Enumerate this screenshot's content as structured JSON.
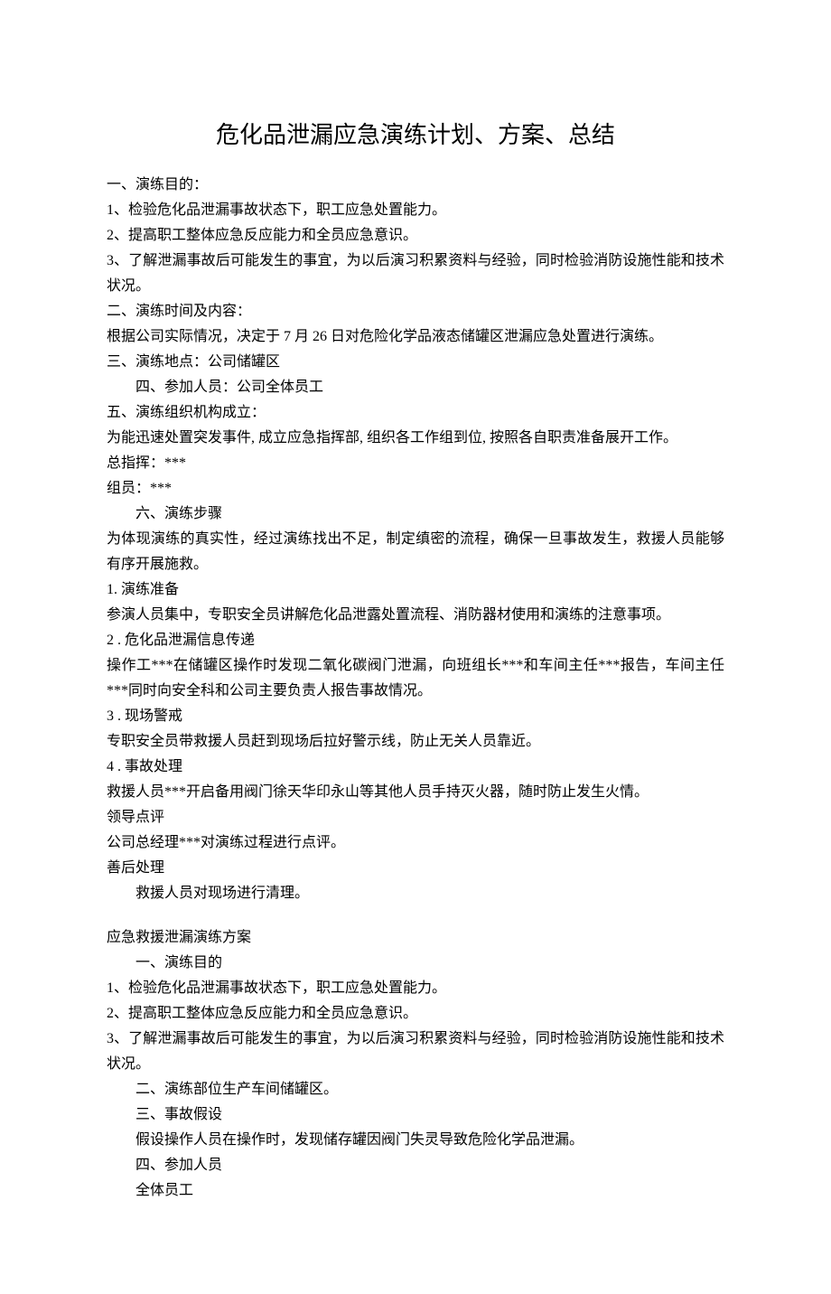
{
  "title": "危化品泄漏应急演练计划、方案、总结",
  "paragraphs": [
    {
      "text": "一、演练目的：",
      "indent": false
    },
    {
      "text": "1、检验危化品泄漏事故状态下，职工应急处置能力。",
      "indent": false
    },
    {
      "text": "2、提高职工整体应急反应能力和全员应急意识。",
      "indent": false
    },
    {
      "text": "3、了解泄漏事故后可能发生的事宜，为以后演习积累资料与经验，同时检验消防设施性能和技术状况。",
      "indent": false
    },
    {
      "text": "二、演练时间及内容：",
      "indent": false
    },
    {
      "text": "根据公司实际情况，决定于 7 月 26 日对危险化学品液态储罐区泄漏应急处置进行演练。",
      "indent": false
    },
    {
      "text": "三、演练地点：公司储罐区",
      "indent": false
    },
    {
      "text": "四、参加人员：公司全体员工",
      "indent": true
    },
    {
      "text": "五、演练组织机构成立：",
      "indent": false
    },
    {
      "text": "为能迅速处置突发事件, 成立应急指挥部, 组织各工作组到位, 按照各自职责准备展开工作。",
      "indent": false
    },
    {
      "text": "总指挥：***",
      "indent": false
    },
    {
      "text": "组员：***",
      "indent": false
    },
    {
      "text": "六、演练步骤",
      "indent": true
    },
    {
      "text": "为体现演练的真实性，经过演练找出不足，制定缜密的流程，确保一旦事故发生，救援人员能够有序开展施救。",
      "indent": false
    },
    {
      "text": "1. 演练准备",
      "indent": false
    },
    {
      "text": "参演人员集中，专职安全员讲解危化品泄露处置流程、消防器材使用和演练的注意事项。",
      "indent": false
    },
    {
      "text": "2  . 危化品泄漏信息传递",
      "indent": false
    },
    {
      "text": "操作工***在储罐区操作时发现二氧化碳阀门泄漏，向班组长***和车间主任***报告，车间主任***同时向安全科和公司主要负责人报告事故情况。",
      "indent": false
    },
    {
      "text": "3  . 现场警戒",
      "indent": false
    },
    {
      "text": "专职安全员带救援人员赶到现场后拉好警示线，防止无关人员靠近。",
      "indent": false
    },
    {
      "text": "4  . 事故处理",
      "indent": false
    },
    {
      "text": "救援人员***开启备用阀门徐天华印永山等其他人员手持灭火器，随时防止发生火情。",
      "indent": false
    },
    {
      "text": "领导点评",
      "indent": false
    },
    {
      "text": "公司总经理***对演练过程进行点评。",
      "indent": false
    },
    {
      "text": "善后处理",
      "indent": false
    },
    {
      "text": "救援人员对现场进行清理。",
      "indent": true
    },
    {
      "text": "应急救援泄漏演练方案",
      "indent": false,
      "gap": true
    },
    {
      "text": "一、演练目的",
      "indent": true
    },
    {
      "text": "1、检验危化品泄漏事故状态下，职工应急处置能力。",
      "indent": false
    },
    {
      "text": "2、提高职工整体应急反应能力和全员应急意识。",
      "indent": false
    },
    {
      "text": "3、了解泄漏事故后可能发生的事宜，为以后演习积累资料与经验，同时检验消防设施性能和技术状况。",
      "indent": false
    },
    {
      "text": "二、演练部位生产车间储罐区。",
      "indent": true
    },
    {
      "text": "三、事故假设",
      "indent": true
    },
    {
      "text": "假设操作人员在操作时，发现储存罐因阀门失灵导致危险化学品泄漏。",
      "indent": true
    },
    {
      "text": "四、参加人员",
      "indent": true
    },
    {
      "text": "全体员工",
      "indent": true
    }
  ]
}
